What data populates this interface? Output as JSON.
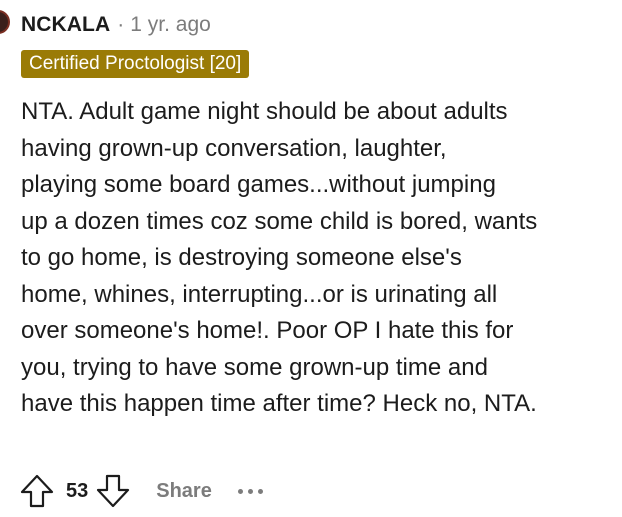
{
  "comment": {
    "author": "NCKALA",
    "separator": "·",
    "timestamp": "1 yr. ago",
    "flair": {
      "text": "Certified Proctologist [20]",
      "color": "#9a7b06"
    },
    "body_lines": [
      "NTA. Adult game night should be about adults",
      "having grown-up conversation, laughter,",
      "playing some board games...without jumping",
      "up a dozen times coz some child is bored, wants",
      "to go home, is destroying someone else's",
      "home, whines, interrupting...or is urinating all",
      "over someone's home!. Poor OP I hate this for",
      "you, trying to have some grown-up time and",
      "have this happen time after time? Heck no, NTA."
    ]
  },
  "actions": {
    "upvote_icon": "upvote-arrow-icon",
    "vote_count": "53",
    "downvote_icon": "downvote-arrow-icon",
    "share_label": "Share",
    "more_icon": "more-options-icon"
  },
  "colors": {
    "text_primary": "#1c1c1c",
    "text_muted": "#7c7c7c",
    "flair_background": "#9a7b06"
  }
}
